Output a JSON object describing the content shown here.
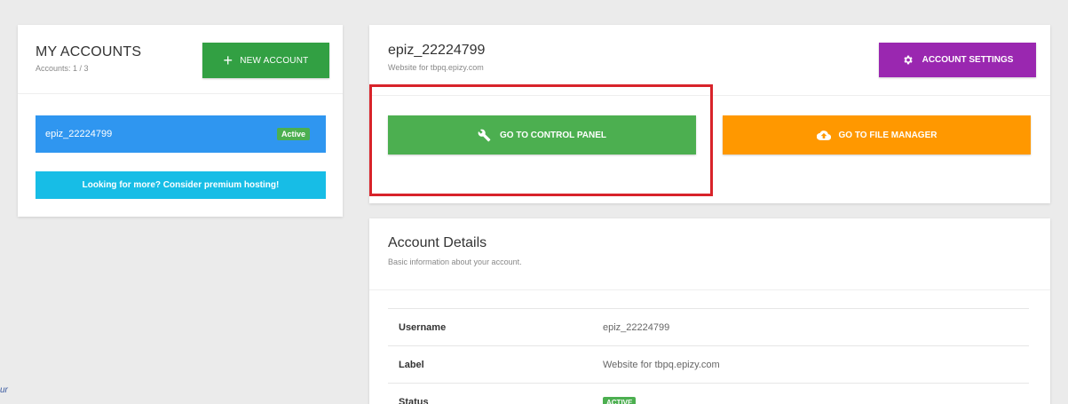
{
  "accounts_panel": {
    "title": "MY ACCOUNTS",
    "count": "Accounts: 1 / 3",
    "new_account_label": "NEW ACCOUNT",
    "account_item": {
      "name": "epiz_22224799",
      "badge": "Active"
    },
    "premium_label": "Looking for more? Consider premium hosting!"
  },
  "main_panel": {
    "title": "epiz_22224799",
    "subtitle": "Website for tbpq.epizy.com",
    "settings_label": "ACCOUNT SETTINGS",
    "control_panel_label": "GO TO CONTROL PANEL",
    "file_manager_label": "GO TO FILE MANAGER"
  },
  "details_panel": {
    "title": "Account Details",
    "subtitle": "Basic information about your account.",
    "rows": [
      {
        "key": "Username",
        "value": "epiz_22224799"
      },
      {
        "key": "Label",
        "value": "Website for tbpq.epizy.com"
      },
      {
        "key": "Status",
        "value": "ACTIVE"
      }
    ]
  },
  "edge_text": "ur",
  "icons": {
    "plus": "plus-icon",
    "gear": "gear-icon",
    "wrench": "wrench-icon",
    "cloud": "cloud-upload-icon"
  },
  "colors": {
    "green": "#4caf50",
    "dark_green": "#32a043",
    "blue": "#2f96f0",
    "cyan": "#17bde6",
    "purple": "#9a27b0",
    "orange": "#ff9800",
    "highlight_red": "#d8232a"
  }
}
